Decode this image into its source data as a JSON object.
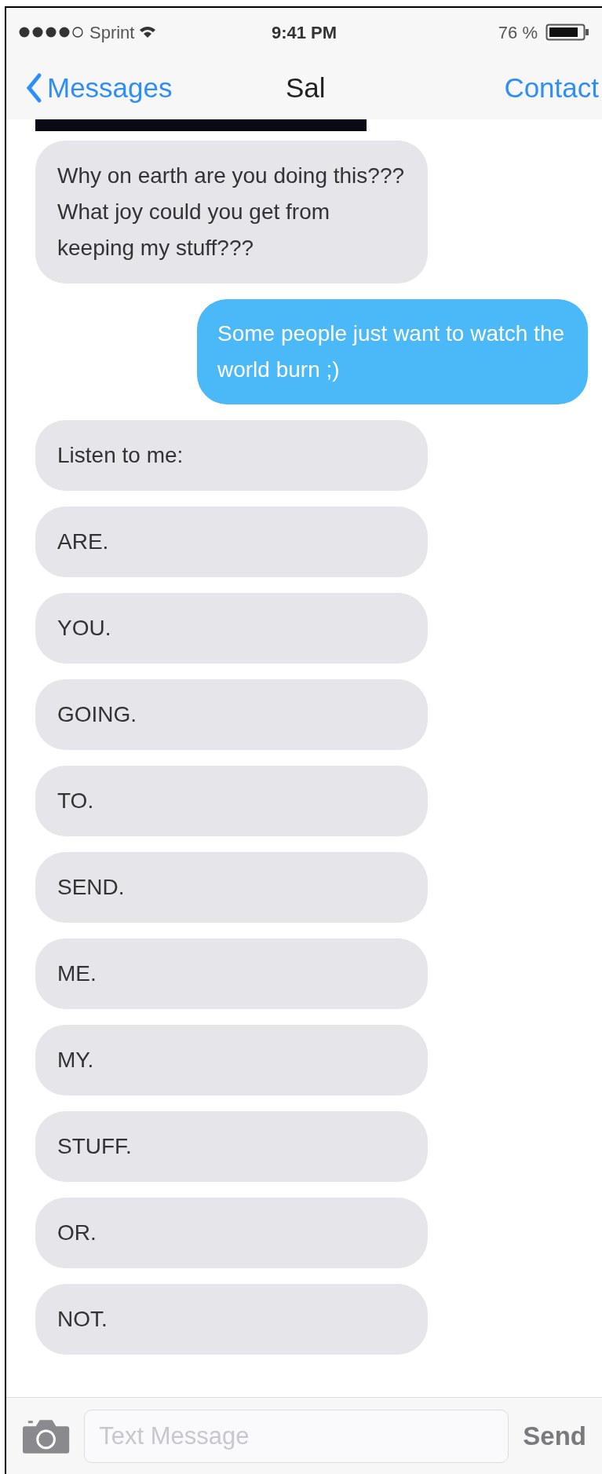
{
  "status_bar": {
    "carrier": "Sprint",
    "time": "9:41 PM",
    "battery": "76 %"
  },
  "nav": {
    "back": "Messages",
    "title": "Sal",
    "action": "Contact"
  },
  "messages": [
    {
      "kind": "image"
    },
    {
      "kind": "received",
      "text": "Why on earth are you doing this??? What joy could you get from keeping my stuff???"
    },
    {
      "kind": "sent",
      "text": "Some people just want to watch the world burn ;)"
    },
    {
      "kind": "received",
      "text": "Listen to me:"
    },
    {
      "kind": "received",
      "text": "ARE."
    },
    {
      "kind": "received",
      "text": "YOU."
    },
    {
      "kind": "received",
      "text": "GOING."
    },
    {
      "kind": "received",
      "text": "TO."
    },
    {
      "kind": "received",
      "text": "SEND."
    },
    {
      "kind": "received",
      "text": "ME."
    },
    {
      "kind": "received",
      "text": "MY."
    },
    {
      "kind": "received",
      "text": "STUFF."
    },
    {
      "kind": "received",
      "text": "OR."
    },
    {
      "kind": "received",
      "text": "NOT."
    }
  ],
  "composer": {
    "placeholder": "Text Message",
    "send": "Send"
  }
}
